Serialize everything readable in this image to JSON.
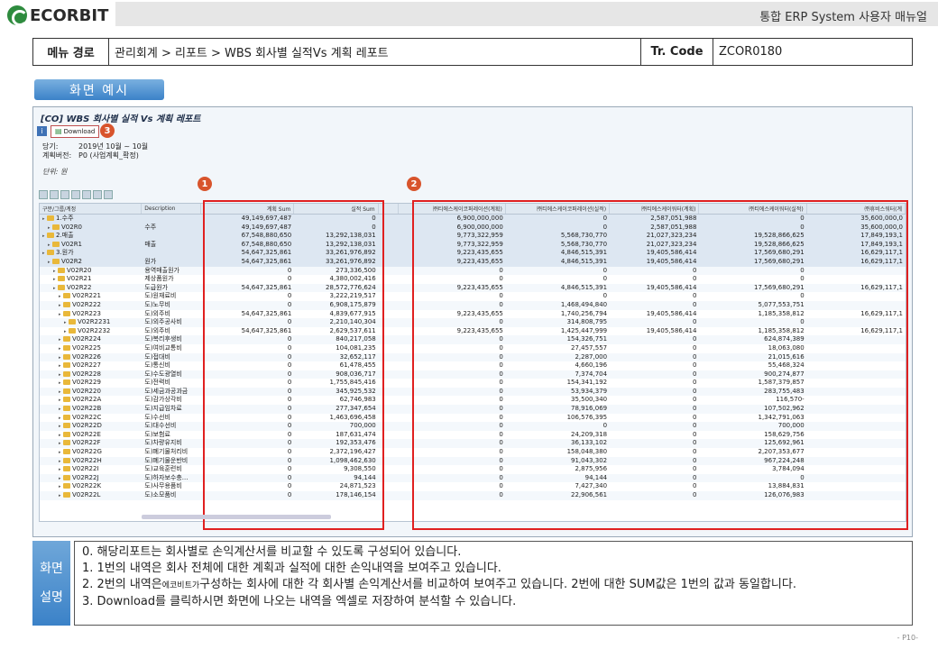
{
  "header": {
    "logo": "ECORBIT",
    "title": "통합 ERP System 사용자 매뉴얼"
  },
  "menu": {
    "path_label": "메뉴 경로",
    "path": "관리회계 > 리포트 > WBS 회사별 실적Vs 계획 레포트",
    "tr_label": "Tr. Code",
    "tr_code": "ZCOR0180"
  },
  "example_label": "화면 예시",
  "sap": {
    "title": "[CO] WBS 회사별 실적 Vs 계획 레포트",
    "download_label": "Download",
    "period_label": "당기:",
    "period": "2019년 10월 ~ 10월",
    "version_label": "계획버전:",
    "version": "P0 (사업계획_확정)",
    "unit": "단위: 원",
    "badges": [
      "1",
      "2",
      "3"
    ],
    "columns": [
      "구분/그룹/계정",
      "Description",
      "계획 Sum",
      "실적 Sum",
      "㈜티에스케이코퍼레이션(계획)",
      "㈜티에스케이코퍼레이션(실적)",
      "㈜티에스케이워터(계획)",
      "㈜티에스케이워터(실적)",
      "㈜휴비스워터(계"
    ],
    "rows": [
      {
        "node": "1.수주",
        "level": 0,
        "desc": "",
        "plan": "49,149,697,487",
        "actual": "0",
        "c1": "6,900,000,000",
        "c2": "0",
        "c3": "2,587,051,988",
        "c4": "0",
        "c5": "35,600,000,0"
      },
      {
        "node": "V02R0",
        "level": 1,
        "desc": "수주",
        "plan": "49,149,697,487",
        "actual": "0",
        "c1": "6,900,000,000",
        "c2": "0",
        "c3": "2,587,051,988",
        "c4": "0",
        "c5": "35,600,000,0"
      },
      {
        "node": "2.매출",
        "level": 0,
        "desc": "",
        "plan": "67,548,880,650",
        "actual": "13,292,138,031",
        "c1": "9,773,322,959",
        "c2": "5,568,730,770",
        "c3": "21,027,323,234",
        "c4": "19,528,866,625",
        "c5": "17,849,193,1"
      },
      {
        "node": "V02R1",
        "level": 1,
        "desc": "매출",
        "plan": "67,548,880,650",
        "actual": "13,292,138,031",
        "c1": "9,773,322,959",
        "c2": "5,568,730,770",
        "c3": "21,027,323,234",
        "c4": "19,528,866,625",
        "c5": "17,849,193,1"
      },
      {
        "node": "3.원가",
        "level": 0,
        "desc": "",
        "plan": "54,647,325,861",
        "actual": "33,261,976,892",
        "c1": "9,223,435,655",
        "c2": "4,846,515,391",
        "c3": "19,405,586,414",
        "c4": "17,569,680,291",
        "c5": "16,629,117,1"
      },
      {
        "node": "V02R2",
        "level": 1,
        "desc": "원가",
        "plan": "54,647,325,861",
        "actual": "33,261,976,892",
        "c1": "9,223,435,655",
        "c2": "4,846,515,391",
        "c3": "19,405,586,414",
        "c4": "17,569,680,291",
        "c5": "16,629,117,1"
      },
      {
        "node": "V02R20",
        "level": 2,
        "desc": "용역매출원가",
        "plan": "0",
        "actual": "273,336,500",
        "c1": "0",
        "c2": "0",
        "c3": "0",
        "c4": "0",
        "c5": ""
      },
      {
        "node": "V02R21",
        "level": 2,
        "desc": "제상품원가",
        "plan": "0",
        "actual": "4,380,002,416",
        "c1": "0",
        "c2": "0",
        "c3": "0",
        "c4": "0",
        "c5": ""
      },
      {
        "node": "V02R22",
        "level": 2,
        "desc": "도급원가",
        "plan": "54,647,325,861",
        "actual": "28,572,776,624",
        "c1": "9,223,435,655",
        "c2": "4,846,515,391",
        "c3": "19,405,586,414",
        "c4": "17,569,680,291",
        "c5": "16,629,117,1"
      },
      {
        "node": "V02R221",
        "level": 3,
        "desc": "도)원재료비",
        "plan": "0",
        "actual": "3,222,219,517",
        "c1": "0",
        "c2": "0",
        "c3": "0",
        "c4": "0",
        "c5": ""
      },
      {
        "node": "V02R222",
        "level": 3,
        "desc": "도)노무비",
        "plan": "0",
        "actual": "6,908,175,879",
        "c1": "0",
        "c2": "1,468,494,840",
        "c3": "0",
        "c4": "5,077,553,751",
        "c5": ""
      },
      {
        "node": "V02R223",
        "level": 3,
        "desc": "도)외주비",
        "plan": "54,647,325,861",
        "actual": "4,839,677,915",
        "c1": "9,223,435,655",
        "c2": "1,740,256,794",
        "c3": "19,405,586,414",
        "c4": "1,185,358,812",
        "c5": "16,629,117,1"
      },
      {
        "node": "V02R2231",
        "level": 4,
        "desc": "도)외주공사비",
        "plan": "0",
        "actual": "2,210,140,304",
        "c1": "0",
        "c2": "314,808,795",
        "c3": "0",
        "c4": "0",
        "c5": ""
      },
      {
        "node": "V02R2232",
        "level": 4,
        "desc": "도)외주비",
        "plan": "54,647,325,861",
        "actual": "2,629,537,611",
        "c1": "9,223,435,655",
        "c2": "1,425,447,999",
        "c3": "19,405,586,414",
        "c4": "1,185,358,812",
        "c5": "16,629,117,1"
      },
      {
        "node": "V02R224",
        "level": 3,
        "desc": "도)복리후생비",
        "plan": "0",
        "actual": "840,217,058",
        "c1": "0",
        "c2": "154,326,751",
        "c3": "0",
        "c4": "624,874,389",
        "c5": ""
      },
      {
        "node": "V02R225",
        "level": 3,
        "desc": "도)여비교통비",
        "plan": "0",
        "actual": "104,081,235",
        "c1": "0",
        "c2": "27,457,557",
        "c3": "0",
        "c4": "18,063,080",
        "c5": ""
      },
      {
        "node": "V02R226",
        "level": 3,
        "desc": "도)접대비",
        "plan": "0",
        "actual": "32,652,117",
        "c1": "0",
        "c2": "2,287,000",
        "c3": "0",
        "c4": "21,015,616",
        "c5": ""
      },
      {
        "node": "V02R227",
        "level": 3,
        "desc": "도)통신비",
        "plan": "0",
        "actual": "61,478,455",
        "c1": "0",
        "c2": "4,660,196",
        "c3": "0",
        "c4": "55,468,324",
        "c5": ""
      },
      {
        "node": "V02R228",
        "level": 3,
        "desc": "도)수도광열비",
        "plan": "0",
        "actual": "908,036,717",
        "c1": "0",
        "c2": "7,374,704",
        "c3": "0",
        "c4": "900,274,877",
        "c5": ""
      },
      {
        "node": "V02R229",
        "level": 3,
        "desc": "도)전력비",
        "plan": "0",
        "actual": "1,755,845,416",
        "c1": "0",
        "c2": "154,341,192",
        "c3": "0",
        "c4": "1,587,379,857",
        "c5": ""
      },
      {
        "node": "V02R220",
        "level": 3,
        "desc": "도)세금과공과금",
        "plan": "0",
        "actual": "345,925,532",
        "c1": "0",
        "c2": "53,934,379",
        "c3": "0",
        "c4": "283,755,483",
        "c5": ""
      },
      {
        "node": "V02R22A",
        "level": 3,
        "desc": "도)감가상각비",
        "plan": "0",
        "actual": "62,746,983",
        "c1": "0",
        "c2": "35,500,340",
        "c3": "0",
        "c4": "116,570-",
        "c5": ""
      },
      {
        "node": "V02R22B",
        "level": 3,
        "desc": "도)지급임차료",
        "plan": "0",
        "actual": "277,347,654",
        "c1": "0",
        "c2": "78,916,069",
        "c3": "0",
        "c4": "107,502,962",
        "c5": ""
      },
      {
        "node": "V02R22C",
        "level": 3,
        "desc": "도)수선비",
        "plan": "0",
        "actual": "1,463,696,458",
        "c1": "0",
        "c2": "106,576,395",
        "c3": "0",
        "c4": "1,342,791,063",
        "c5": ""
      },
      {
        "node": "V02R22D",
        "level": 3,
        "desc": "도)대수선비",
        "plan": "0",
        "actual": "700,000",
        "c1": "0",
        "c2": "0",
        "c3": "0",
        "c4": "700,000",
        "c5": ""
      },
      {
        "node": "V02R22E",
        "level": 3,
        "desc": "도)보험료",
        "plan": "0",
        "actual": "187,631,474",
        "c1": "0",
        "c2": "24,209,318",
        "c3": "0",
        "c4": "158,629,756",
        "c5": ""
      },
      {
        "node": "V02R22F",
        "level": 3,
        "desc": "도)차량유지비",
        "plan": "0",
        "actual": "192,353,476",
        "c1": "0",
        "c2": "36,133,102",
        "c3": "0",
        "c4": "125,692,961",
        "c5": ""
      },
      {
        "node": "V02R22G",
        "level": 3,
        "desc": "도)폐기물처리비",
        "plan": "0",
        "actual": "2,372,196,427",
        "c1": "0",
        "c2": "158,048,380",
        "c3": "0",
        "c4": "2,207,353,677",
        "c5": ""
      },
      {
        "node": "V02R22H",
        "level": 3,
        "desc": "도)폐기물운반비",
        "plan": "0",
        "actual": "1,098,462,630",
        "c1": "0",
        "c2": "91,043,302",
        "c3": "0",
        "c4": "967,224,248",
        "c5": ""
      },
      {
        "node": "V02R22I",
        "level": 3,
        "desc": "도)교육훈련비",
        "plan": "0",
        "actual": "9,308,550",
        "c1": "0",
        "c2": "2,875,956",
        "c3": "0",
        "c4": "3,784,094",
        "c5": ""
      },
      {
        "node": "V02R22J",
        "level": 3,
        "desc": "도)하자보수충...",
        "plan": "0",
        "actual": "94,144",
        "c1": "0",
        "c2": "94,144",
        "c3": "0",
        "c4": "0",
        "c5": ""
      },
      {
        "node": "V02R22K",
        "level": 3,
        "desc": "도)사무용품비",
        "plan": "0",
        "actual": "24,871,523",
        "c1": "0",
        "c2": "7,427,340",
        "c3": "0",
        "c4": "13,884,831",
        "c5": ""
      },
      {
        "node": "V02R22L",
        "level": 3,
        "desc": "도)소모품비",
        "plan": "0",
        "actual": "178,146,154",
        "c1": "0",
        "c2": "22,906,561",
        "c3": "0",
        "c4": "126,076,983",
        "c5": ""
      }
    ]
  },
  "description": {
    "label_line1": "화면",
    "label_line2": "설명",
    "line0": "0. 해당리포트는 회사별로 손익계산서를 비교할 수 있도록 구성되어 있습니다.",
    "line1": "1.   1번의 내역은       회사 전체에 대한 계획과 실적에 대한 손익내역을 보여주고 있습니다.",
    "line2_a": "2.   2번의 내역은",
    "line2_em": "에코비트가",
    "line2_b": "구성하는 회사에 대한 각 회사별 손익계산서를 비교하여 보여주고 있습니다. 2번에 대한 SUM값은 1번의 값과 동일합니다.",
    "line3": "3.   Download를 클릭하시면 화면에 나오는 내역을 엑셀로 저장하여 분석할 수 있습니다."
  },
  "page_number": "- P10-"
}
